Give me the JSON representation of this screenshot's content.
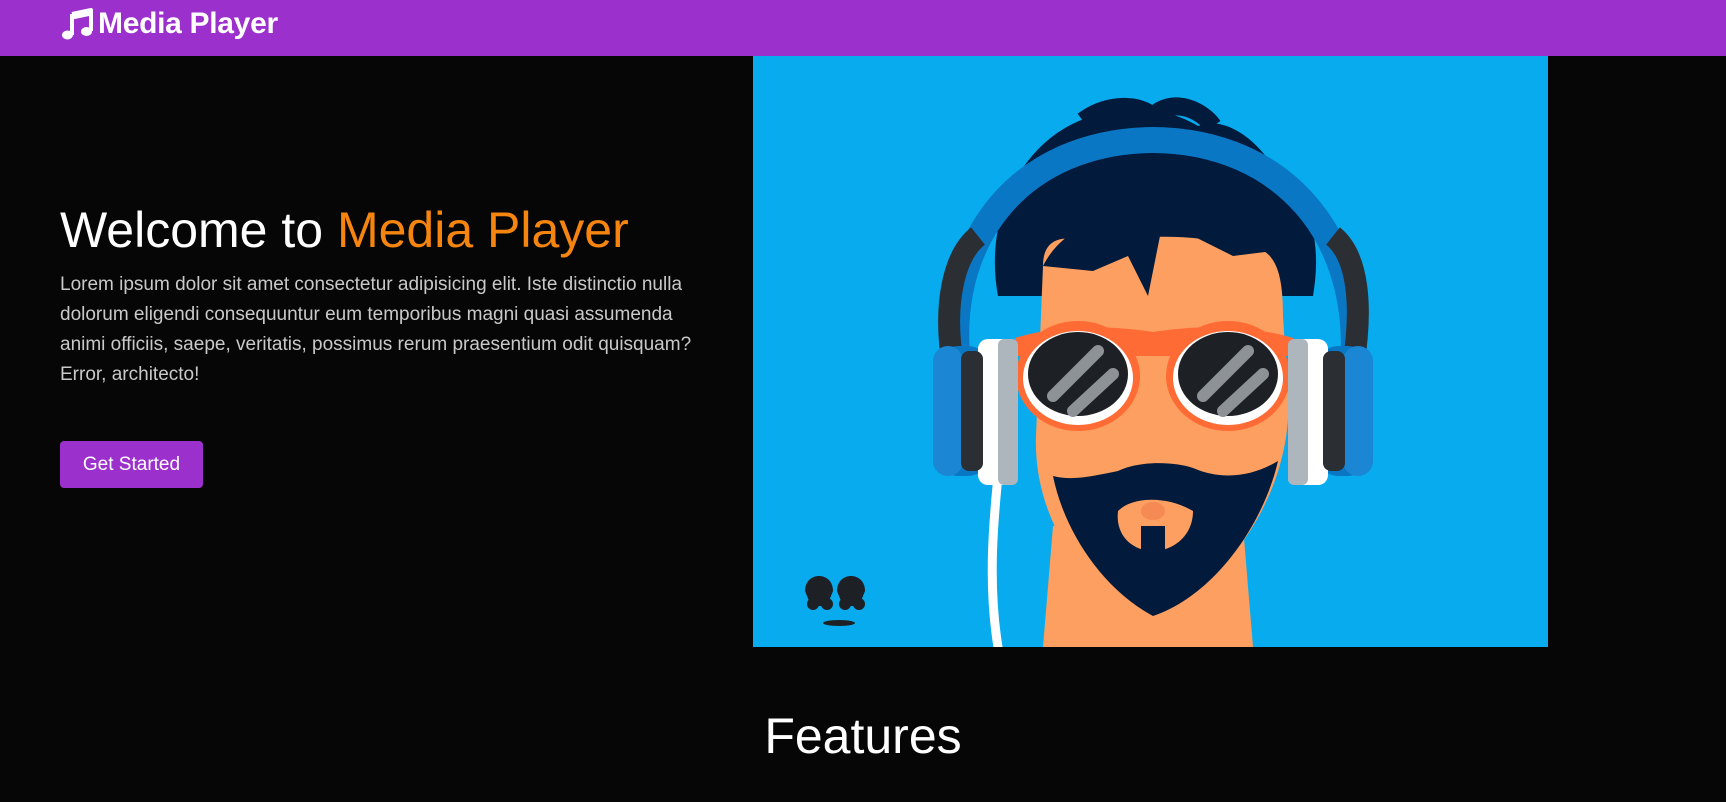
{
  "navbar": {
    "brand_icon": "music-note-icon",
    "brand_text": "Media Player",
    "background": "#9b30cc"
  },
  "hero": {
    "title_prefix": "Welcome to",
    "title_accent": "Media Player",
    "accent_color": "#f5850e",
    "description": "Lorem ipsum dolor sit amet consectetur adipisicing elit. Iste distinctio nulla dolorum eligendi consequuntur eum temporibus magni quasi assumenda animi officiis, saepe, veritatis, possimus rerum praesentium odit quisquam? Error, architecto!",
    "cta_label": "Get Started",
    "illustration": "man-with-headphones-illustration",
    "illustration_background": "#07abee"
  },
  "features": {
    "heading": "Features"
  }
}
